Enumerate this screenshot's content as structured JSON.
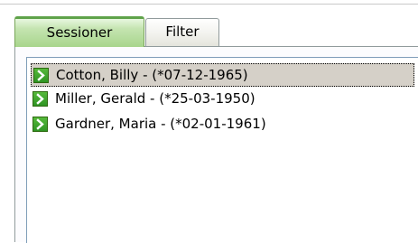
{
  "tabs": [
    {
      "label": "Sessioner",
      "active": true
    },
    {
      "label": "Filter",
      "active": false
    }
  ],
  "sessions": [
    {
      "label": "Cotton, Billy - (*07-12-1965)",
      "icon": "green-arrow-icon",
      "selected": true
    },
    {
      "label": "Miller, Gerald - (*25-03-1950)",
      "icon": "green-arrow-icon",
      "selected": false
    },
    {
      "label": "Gardner, Maria - (*02-01-1961)",
      "icon": "green-arrow-icon",
      "selected": false
    }
  ],
  "colors": {
    "active_tab": "#a8d58c",
    "active_tab_top": "#5fa34a",
    "arrow_icon": "#3aa02c",
    "selection": "#d5d0c8"
  }
}
